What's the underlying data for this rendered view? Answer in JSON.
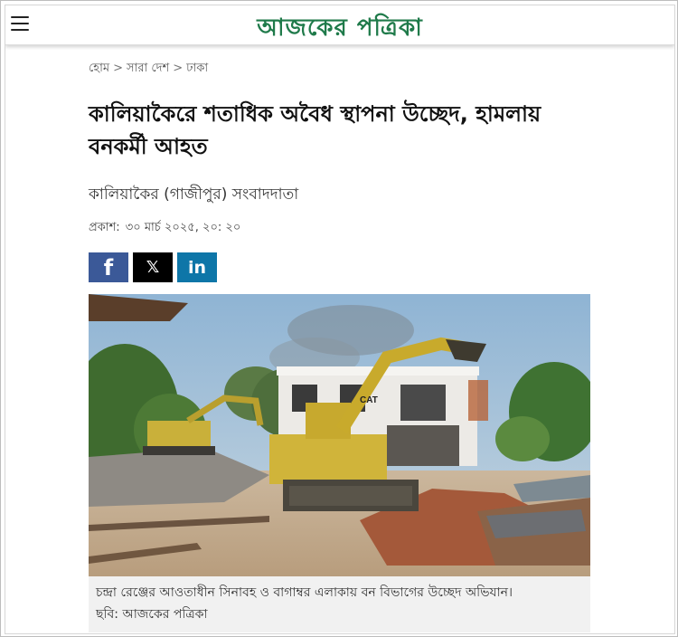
{
  "header": {
    "logo_text": "আজকের পত্রিকা",
    "menu_icon": "hamburger-menu-icon",
    "brand_color": "#1f7a4a"
  },
  "breadcrumb": {
    "items": [
      "হোম",
      "সারা দেশ",
      "ঢাকা"
    ],
    "separator": ">"
  },
  "article": {
    "headline": "কালিয়াকৈরে শতাধিক অবৈধ স্থাপনা উচ্ছেদ, হামলায় বনকর্মী আহত",
    "byline": "কালিয়াকৈর (গাজীপুর) সংবাদদাতা",
    "published_label": "প্রকাশ:",
    "published_value": "৩০ মার্চ ২০২৫, ২০: ২০"
  },
  "share": {
    "facebook": {
      "icon": "facebook-icon",
      "glyph": "f",
      "color": "#3b5998"
    },
    "x": {
      "icon": "x-icon",
      "glyph": "𝕏",
      "color": "#000000"
    },
    "linkedin": {
      "icon": "linkedin-icon",
      "glyph": "in",
      "color": "#0e76a8"
    }
  },
  "photo": {
    "caption": "চন্দ্রা রেঞ্জের আওতাধীন সিনাবহ ও বাগাম্বর এলাকায় বন বিভাগের উচ্ছেদ অভিযান।",
    "credit": "ছবি: আজকের পত্রিকা",
    "machine_brand": "CAT"
  }
}
